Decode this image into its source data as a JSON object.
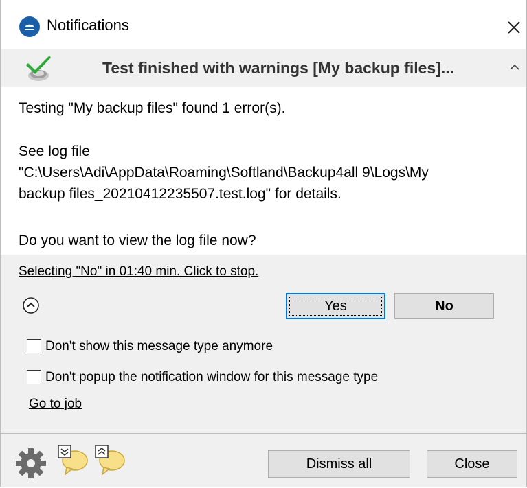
{
  "window": {
    "title": "Notifications",
    "close_icon": "close-icon",
    "app_icon": "backup4all-logo-icon"
  },
  "header": {
    "status_icon": "check-success-icon",
    "title": "Test finished with warnings [My backup files]...",
    "collapse_icon": "chevron-up-icon"
  },
  "message": {
    "line1": "Testing \"My backup files\" found 1 error(s).",
    "line2": "See log file",
    "line3": "\"C:\\Users\\Adi\\AppData\\Roaming\\Softland\\Backup4all 9\\Logs\\My",
    "line4": "backup files_20210412235507.test.log\" for details.",
    "question": "Do you want to view the log file now?"
  },
  "actions": {
    "countdown_link": "Selecting \"No\" in 01:40 min. Click to stop.",
    "expand_icon": "circle-chevron-up-icon",
    "yes_label": "Yes",
    "no_label": "No",
    "checkbox_1_label": "Don't show this message type anymore",
    "checkbox_1_checked": false,
    "checkbox_2_label": "Don't popup the notification window for this message type",
    "checkbox_2_checked": false,
    "go_to_job_link": "Go to job"
  },
  "footer": {
    "settings_icon": "gear-icon",
    "expand_all_icon": "expand-all-bubble-icon",
    "collapse_all_icon": "collapse-all-bubble-icon",
    "dismiss_all_label": "Dismiss all",
    "close_label": "Close"
  },
  "colors": {
    "accent": "#0078d7",
    "logo_blue": "#1a5ea8",
    "check_green": "#2fa83a",
    "bubble_yellow": "#f8e08a",
    "panel_gray": "#f0f0f0",
    "button_gray": "#e1e1e1"
  }
}
